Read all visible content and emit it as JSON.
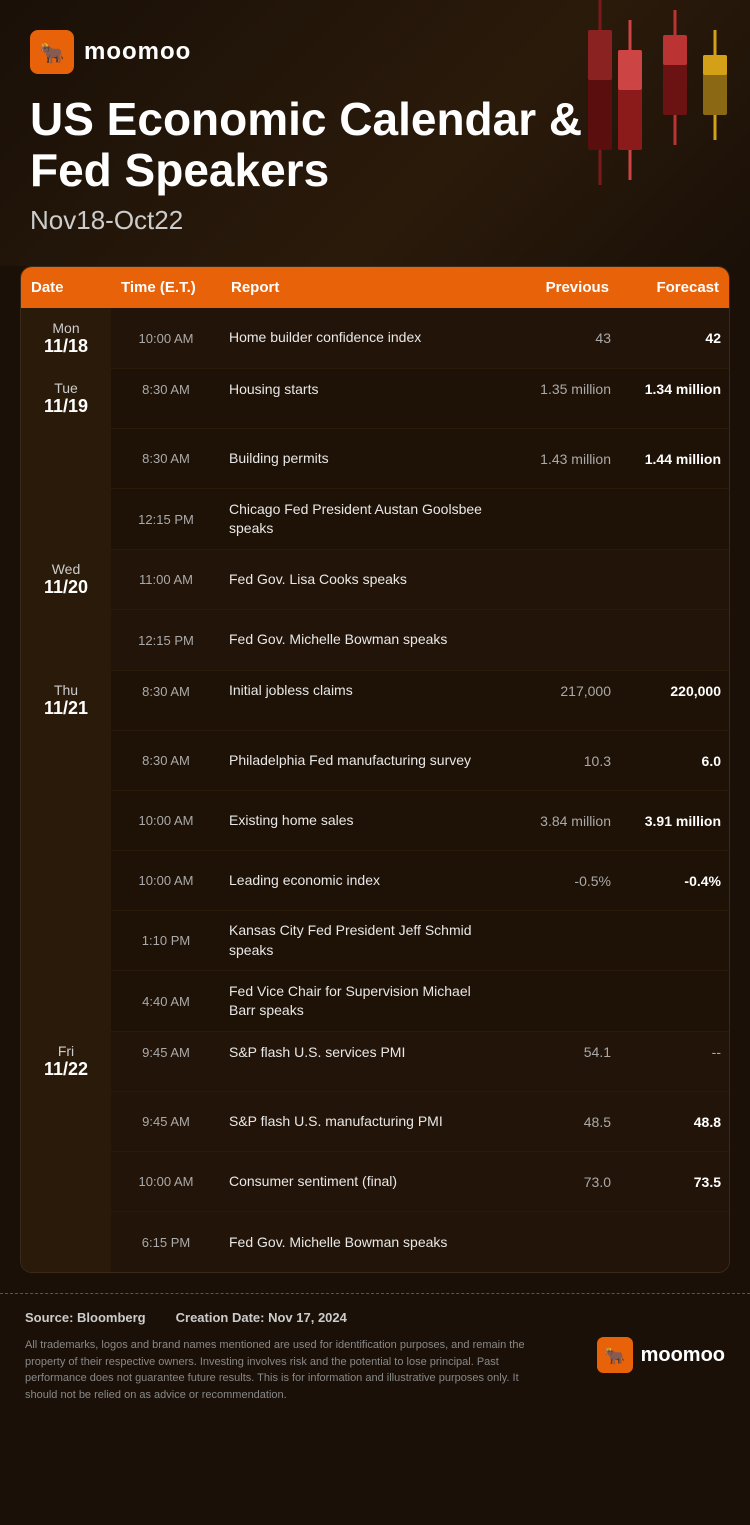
{
  "app": {
    "logo_text": "moomoo",
    "title": "US Economic Calendar & Fed Speakers",
    "date_range": "Nov18-Oct22"
  },
  "table": {
    "headers": {
      "date": "Date",
      "time": "Time (E.T.)",
      "report": "Report",
      "previous": "Previous",
      "forecast": "Forecast"
    },
    "days": [
      {
        "day_name": "Mon",
        "day_date": "11/18",
        "events": [
          {
            "time": "10:00 AM",
            "report": "Home builder confidence index",
            "previous": "43",
            "forecast": "42",
            "forecast_bold": true
          }
        ]
      },
      {
        "day_name": "Tue",
        "day_date": "11/19",
        "events": [
          {
            "time": "8:30 AM",
            "report": "Housing starts",
            "previous": "1.35 million",
            "forecast": "1.34 million",
            "forecast_bold": true
          },
          {
            "time": "8:30 AM",
            "report": "Building permits",
            "previous": "1.43 million",
            "forecast": "1.44 million",
            "forecast_bold": true
          },
          {
            "time": "12:15 PM",
            "report": "Chicago Fed President Austan Goolsbee speaks",
            "previous": "",
            "forecast": "",
            "forecast_bold": false
          }
        ]
      },
      {
        "day_name": "Wed",
        "day_date": "11/20",
        "events": [
          {
            "time": "11:00 AM",
            "report": "Fed Gov. Lisa Cooks speaks",
            "previous": "",
            "forecast": "",
            "forecast_bold": false
          },
          {
            "time": "12:15 PM",
            "report": "Fed Gov. Michelle Bowman speaks",
            "previous": "",
            "forecast": "",
            "forecast_bold": false
          }
        ]
      },
      {
        "day_name": "Thu",
        "day_date": "11/21",
        "events": [
          {
            "time": "8:30 AM",
            "report": "Initial jobless claims",
            "previous": "217,000",
            "forecast": "220,000",
            "forecast_bold": true
          },
          {
            "time": "8:30 AM",
            "report": "Philadelphia Fed manufacturing survey",
            "previous": "10.3",
            "forecast": "6.0",
            "forecast_bold": true
          },
          {
            "time": "10:00 AM",
            "report": "Existing home sales",
            "previous": "3.84 million",
            "forecast": "3.91 million",
            "forecast_bold": true
          },
          {
            "time": "10:00 AM",
            "report": "Leading economic index",
            "previous": "-0.5%",
            "forecast": "-0.4%",
            "forecast_bold": true
          },
          {
            "time": "1:10 PM",
            "report": "Kansas City Fed President Jeff Schmid speaks",
            "previous": "",
            "forecast": "",
            "forecast_bold": false
          },
          {
            "time": "4:40 AM",
            "report": "Fed Vice Chair for Supervision Michael Barr speaks",
            "previous": "",
            "forecast": "",
            "forecast_bold": false
          }
        ]
      },
      {
        "day_name": "Fri",
        "day_date": "11/22",
        "events": [
          {
            "time": "9:45 AM",
            "report": "S&P flash U.S. services PMI",
            "previous": "54.1",
            "forecast": "--",
            "forecast_bold": false,
            "forecast_dash": true
          },
          {
            "time": "9:45 AM",
            "report": "S&P flash U.S. manufacturing PMI",
            "previous": "48.5",
            "forecast": "48.8",
            "forecast_bold": true
          },
          {
            "time": "10:00 AM",
            "report": "Consumer sentiment (final)",
            "previous": "73.0",
            "forecast": "73.5",
            "forecast_bold": true
          },
          {
            "time": "6:15 PM",
            "report": "Fed Gov. Michelle Bowman speaks",
            "previous": "",
            "forecast": "",
            "forecast_bold": false
          }
        ]
      }
    ]
  },
  "footer": {
    "source_label": "Source: Bloomberg",
    "date_label": "Creation Date: Nov 17, 2024",
    "disclaimer": "All trademarks, logos and brand names mentioned are used for identification purposes, and remain the property of their respective owners. Investing involves risk and the potential to lose principal. Past performance does not guarantee future results. This is for information and illustrative purposes only. It should not be relied on as advice or recommendation.",
    "logo_text": "moomoo"
  }
}
